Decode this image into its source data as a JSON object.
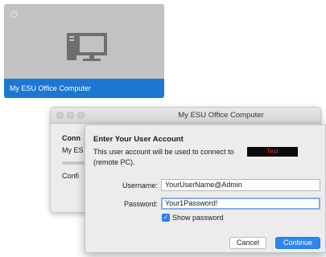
{
  "tile": {
    "close_symbol": "×",
    "icon": "desktop-computer-icon",
    "label": "My ESU Office Computer",
    "accent": "#1c77d3"
  },
  "background_window": {
    "title": "My ESU Office Computer",
    "heading_partial": "Conn",
    "text_partial": "My ES",
    "text2_partial": "Confi"
  },
  "sheet": {
    "title": "Enter Your User Account",
    "description_line1": "This user account will be used to connect to",
    "redacted_text": "Text",
    "description_line2": "(remote PC).",
    "username_label": "Username:",
    "username_value": "YourUserName@Admin",
    "password_label": "Password:",
    "password_value": "Your1Password!",
    "show_password_label": "Show password",
    "show_password_checked": true,
    "cancel_label": "Cancel",
    "continue_label": "Continue",
    "continue_color": "#2f86f2"
  }
}
